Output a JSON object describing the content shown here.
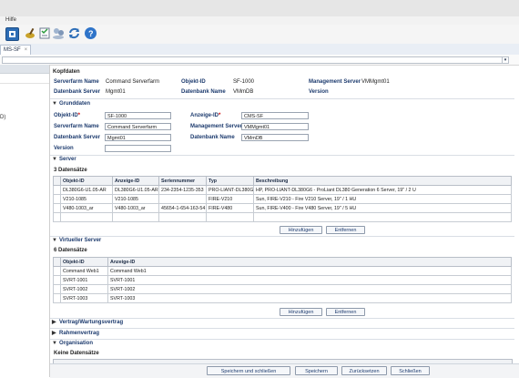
{
  "menu": {
    "help": "Hilfe"
  },
  "tab": {
    "label": "MS-SF",
    "close": "×"
  },
  "kopfdaten": {
    "title": "Kopfdaten",
    "serverfarm_label": "Serverfarm Name",
    "serverfarm_value": "Command Serverfarm",
    "objekt_label": "Objekt-ID",
    "objekt_value": "SF-1000",
    "mgmt_label": "Management Server",
    "mgmt_value": "VMMgmt01",
    "dbserver_label": "Datenbank Server",
    "dbserver_value": "Mgmt01",
    "dbname_label": "Datenbank Name",
    "dbname_value": "VMmDB",
    "version_label": "Version"
  },
  "grunddaten": {
    "title": "Grunddaten",
    "objekt_label": "Objekt-ID",
    "objekt_value": "SF-1000",
    "req": "*",
    "anzeige_label": "Anzeige-ID",
    "anzeige_value": "CMS-SF",
    "serverfarm_label": "Serverfarm Name",
    "serverfarm_value": "Command Serverfarm",
    "mgmt_label": "Management Server",
    "mgmt_value": "VMMgmt01",
    "dbserver_label": "Datenbank Server",
    "dbserver_value": "Mgmt01",
    "dbname_label": "Datenbank Name",
    "dbname_value": "VMmDB",
    "version_label": "Version",
    "version_value": ""
  },
  "server": {
    "title": "Server",
    "count": "3 Datensätze",
    "columns": [
      "Objekt-ID",
      "Anzeige-ID",
      "Seriennummer",
      "Typ",
      "Beschreibung"
    ],
    "rows": [
      [
        "DL380G6-U1.05-AR",
        "DL380G6-U1.05-AR",
        "234-2354-1235-353",
        "PRO-LIANT-DL380G6",
        "HP, PRO-LIANT-DL380G6 - ProLiant DL380 Generation 6 Server, 19\" / 2 U"
      ],
      [
        "V210-1085",
        "V210-1085",
        "",
        "FIRE-V210",
        "Sun, FIRE-V210 - Fire V210 Server, 19\" / 1 HU"
      ],
      [
        "V480-1003_ar",
        "V480-1003_ar",
        "45654-1-654-163-54",
        "FIRE-V480",
        "Sun, FIRE-V400 - Fire V480 Server, 19\" / 5 HU"
      ]
    ],
    "add": "Hinzufügen",
    "remove": "Entfernen"
  },
  "virtuell": {
    "title": "Virtueller Server",
    "count": "6 Datensätze",
    "columns": [
      "Objekt-ID",
      "Anzeige-ID"
    ],
    "rows": [
      [
        "Command Web1",
        "Command Web1"
      ],
      [
        "SVRT-1001",
        "SVRT-1001"
      ],
      [
        "SVRT-1002",
        "SVRT-1002"
      ],
      [
        "SVRT-1003",
        "SVRT-1003"
      ]
    ],
    "add": "Hinzufügen",
    "remove": "Entfernen"
  },
  "vertrag": {
    "title": "Vertrag/Wartungsvertrag"
  },
  "rahmen": {
    "title": "Rahmenvertrag"
  },
  "organisation": {
    "title": "Organisation",
    "count": "Keine Datensätze"
  },
  "leftnav": {
    "fragment": "D)"
  },
  "footer": {
    "save_close": "Speichern und schließen",
    "save": "Speichern",
    "reset": "Zurücksetzen",
    "close": "Schließen"
  },
  "colors": {
    "accent": "#1d3b6e",
    "header_bg": "#dfe4ea"
  },
  "icons": [
    "refresh-icon",
    "brush-icon",
    "checklist-icon",
    "users-icon",
    "sync-icon",
    "help-icon"
  ]
}
